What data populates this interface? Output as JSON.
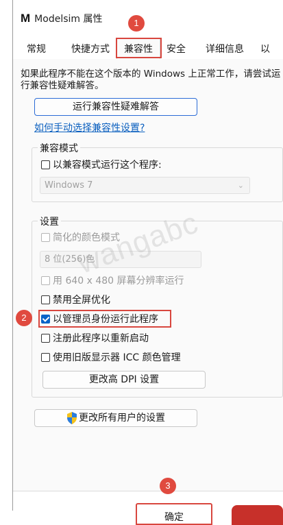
{
  "window": {
    "logo": "M",
    "title": "Modelsim 属性"
  },
  "tabs": [
    {
      "label": "常规"
    },
    {
      "label": "快捷方式"
    },
    {
      "label": "兼容性"
    },
    {
      "label": "安全"
    },
    {
      "label": "详细信息"
    },
    {
      "label": "以"
    }
  ],
  "intro": "如果此程序不能在这个版本的 Windows 上正常工作，请尝试运行兼容性疑难解答。",
  "troubleshoot_button": "运行兼容性疑难解答",
  "manual_link": "如何手动选择兼容性设置?",
  "compat_mode": {
    "label": "兼容模式",
    "checkbox": "以兼容模式运行这个程序:",
    "os_select": "Windows 7"
  },
  "settings": {
    "label": "设置",
    "reduced_color": "简化的颜色模式",
    "color_select": "8 位(256)色",
    "resolution": "用 640 x 480 屏幕分辨率运行",
    "disable_fullscreen": "禁用全屏优化",
    "run_as_admin": "以管理员身份运行此程序",
    "register_restart": "注册此程序以重新启动",
    "legacy_icc": "使用旧版显示器 ICC 颜色管理",
    "dpi_button": "更改高 DPI 设置"
  },
  "all_users_button": "更改所有用户的设置",
  "ok_button": "确定",
  "markers": [
    "1",
    "2",
    "3"
  ],
  "watermark": "wangabc",
  "colors": {
    "accent": "#0a64c8",
    "callout": "#d8463e",
    "link": "#0a5fbf"
  }
}
